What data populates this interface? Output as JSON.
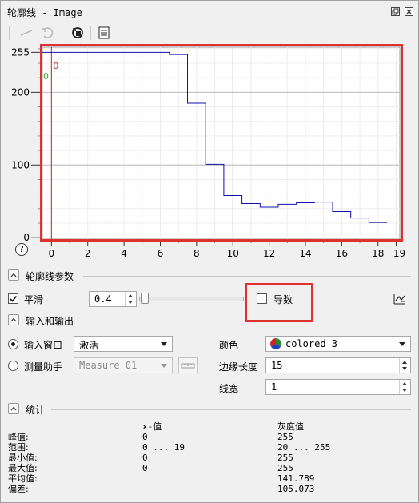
{
  "window": {
    "title": "轮廓线 - Image"
  },
  "chart_data": {
    "type": "line",
    "title": "",
    "xlabel": "",
    "ylabel": "",
    "xlim": [
      -0.5,
      19.2
    ],
    "ylim": [
      -2,
      262
    ],
    "x_ticks": [
      0,
      2,
      4,
      6,
      8,
      10,
      12,
      14,
      16,
      18,
      19
    ],
    "y_ticks": [
      0,
      100,
      200,
      255
    ],
    "series": [
      {
        "color": "#1010b0",
        "step": true,
        "points": [
          [
            -0.5,
            255
          ],
          [
            6.5,
            255
          ],
          [
            6.5,
            252
          ],
          [
            7.5,
            252
          ],
          [
            7.5,
            185
          ],
          [
            8.5,
            185
          ],
          [
            8.5,
            101
          ],
          [
            9.5,
            101
          ],
          [
            9.5,
            58
          ],
          [
            10.5,
            58
          ],
          [
            10.5,
            47
          ],
          [
            11.5,
            47
          ],
          [
            11.5,
            42
          ],
          [
            12.5,
            42
          ],
          [
            12.5,
            46
          ],
          [
            13.5,
            46
          ],
          [
            13.5,
            48
          ],
          [
            14.5,
            48
          ],
          [
            14.5,
            49
          ],
          [
            15.5,
            49
          ],
          [
            15.5,
            36
          ],
          [
            16.5,
            36
          ],
          [
            16.5,
            27
          ],
          [
            17.5,
            27
          ],
          [
            17.5,
            21
          ],
          [
            18.5,
            21
          ]
        ]
      }
    ],
    "markers": [
      {
        "label": "0",
        "x": 0,
        "color": "#d03030"
      },
      {
        "label": "0",
        "x": -0.5,
        "color": "#30b030"
      }
    ]
  },
  "chart_labels": {
    "help": "?"
  },
  "profile_params": {
    "title": "轮廓线参数",
    "smooth_label": "平滑",
    "smooth_checked": true,
    "smooth_value": "0.4",
    "smooth_fraction": 0.02,
    "derivative_label": "导数",
    "derivative_checked": false
  },
  "io": {
    "title": "输入和输出",
    "input_window_label": "输入窗口",
    "input_window_value": "激活",
    "measure_helper_label": "测量助手",
    "measure_value": "Measure 01",
    "color_label": "颜色",
    "color_value": "colored 3",
    "edge_length_label": "边缘长度",
    "edge_length_value": "15",
    "line_width_label": "线宽",
    "line_width_value": "1"
  },
  "stats": {
    "title": "统计",
    "col_x": "x-值",
    "col_gray": "灰度值",
    "rows": [
      {
        "label": "峰值:",
        "x": "0",
        "gray": "255"
      },
      {
        "label": "范围:",
        "x": "0 ... 19",
        "gray": "20 ... 255"
      },
      {
        "label": "最小值:",
        "x": "0",
        "gray": "255"
      },
      {
        "label": "最大值:",
        "x": "0",
        "gray": "255"
      },
      {
        "label": "平均值:",
        "x": "",
        "gray": "141.789"
      },
      {
        "label": "偏差:",
        "x": "",
        "gray": "105.073"
      }
    ]
  },
  "colors": {
    "highlight": "#e03030",
    "line": "#1010b0"
  }
}
